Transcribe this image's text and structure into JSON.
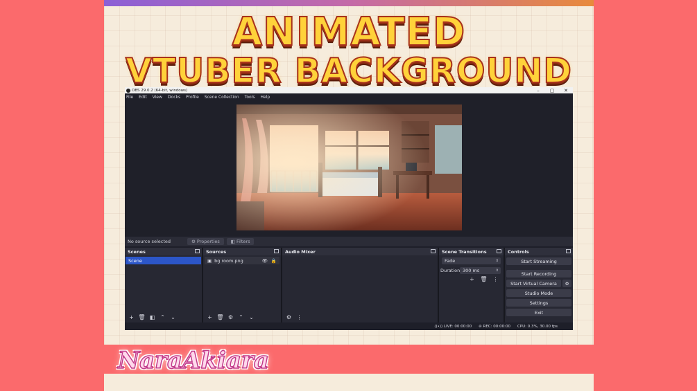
{
  "headline": {
    "line1": "ANIMATED",
    "line2": "VTUBER BACKGROUND"
  },
  "signature": "NaraAkiara",
  "watermark": "NaraAkiara",
  "obs": {
    "title": "OBS 29.0.2 (64-bit, windows)",
    "window_buttons": [
      "–",
      "▢",
      "✕"
    ],
    "menu": [
      "File",
      "Edit",
      "View",
      "Docks",
      "Profile",
      "Scene Collection",
      "Tools",
      "Help"
    ],
    "source_bar": {
      "no_source": "No source selected",
      "properties": "Properties",
      "filters": "Filters"
    },
    "docks": {
      "scenes": {
        "title": "Scenes",
        "items": [
          "Scene"
        ]
      },
      "sources": {
        "title": "Sources",
        "items": [
          {
            "name": "bg room.png"
          }
        ]
      },
      "audio_mixer": {
        "title": "Audio Mixer"
      },
      "transitions": {
        "title": "Scene Transitions",
        "selected": "Fade",
        "duration_label": "Duration",
        "duration_value": "300 ms"
      },
      "controls": {
        "title": "Controls",
        "buttons": [
          "Start Streaming",
          "Start Recording",
          "Start Virtual Camera",
          "Studio Mode",
          "Settings",
          "Exit"
        ]
      }
    },
    "status": {
      "live": "LIVE: 00:00:00",
      "rec": "REC: 00:00:00",
      "cpu": "CPU: 0.3%, 30.00 fps"
    }
  },
  "colors": {
    "background": "#fb6a6c",
    "card": "#f6ecdc",
    "headline_fill": "#ffd23a",
    "headline_stroke": "#a8321c",
    "obs_dark": "#1e1f29",
    "selected_row": "#2c56c8"
  }
}
